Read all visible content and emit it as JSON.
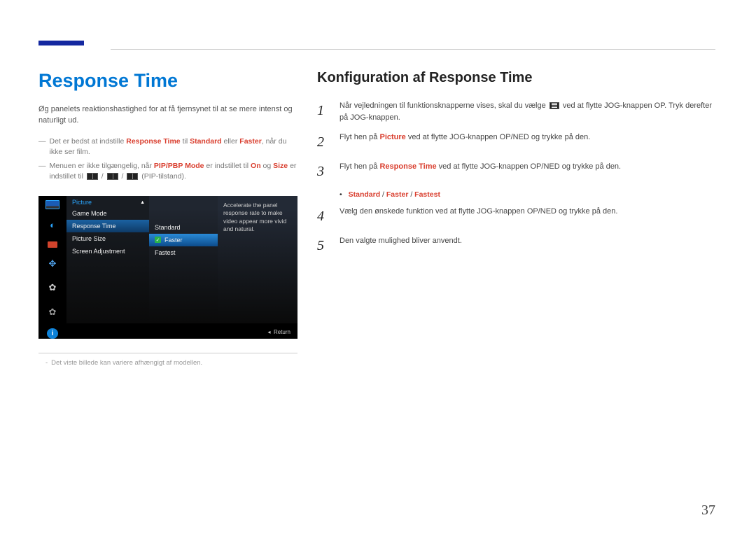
{
  "page_number": "37",
  "left": {
    "title": "Response Time",
    "intro": "Øg panelets reaktionshastighed for at få fjernsynet til at se mere intenst og naturligt ud.",
    "note1_pre": "Det er bedst at indstille ",
    "note1_rt": "Response Time",
    "note1_mid": " til ",
    "note1_std": "Standard",
    "note1_mid2": " eller ",
    "note1_fst": "Faster",
    "note1_suf": ", når du ikke ser film.",
    "note2_pre": "Menuen er ikke tilgængelig, når ",
    "note2_pip": "PIP/PBP Mode",
    "note2_mid": " er indstillet til ",
    "note2_on": "On",
    "note2_mid2": " og ",
    "note2_size": "Size",
    "note2_mid3": " er indstillet til ",
    "note2_suf": " (PIP-tilstand).",
    "footnote": "Det viste billede kan variere afhængigt af modellen."
  },
  "osd": {
    "col1_title": "Picture",
    "col1_items": [
      "Game Mode",
      "Response Time",
      "Picture Size",
      "Screen Adjustment"
    ],
    "col1_selected_index": 1,
    "col2_items": [
      "Standard",
      "Faster",
      "Fastest"
    ],
    "col2_selected_index": 1,
    "desc": "Accelerate the panel response rate to make video appear more vivid and natural.",
    "return": "Return"
  },
  "right": {
    "title": "Konfiguration af Response Time",
    "step1_pre": "Når vejledningen til funktionsknapperne vises, skal du vælge ",
    "step1_suf": " ved at flytte JOG-knappen OP. Tryk derefter på JOG-knappen.",
    "step2_pre": "Flyt hen på ",
    "step2_pic": "Picture",
    "step2_suf": " ved at flytte JOG-knappen OP/NED og trykke på den.",
    "step3_pre": "Flyt hen på ",
    "step3_rt": "Response Time",
    "step3_suf": " ved at flytte JOG-knappen OP/NED og trykke på den.",
    "options_std": "Standard",
    "options_sep": " / ",
    "options_fst": "Faster",
    "options_fstst": "Fastest",
    "step4": "Vælg den ønskede funktion ved at flytte JOG-knappen OP/NED og trykke på den.",
    "step5": "Den valgte mulighed bliver anvendt."
  }
}
